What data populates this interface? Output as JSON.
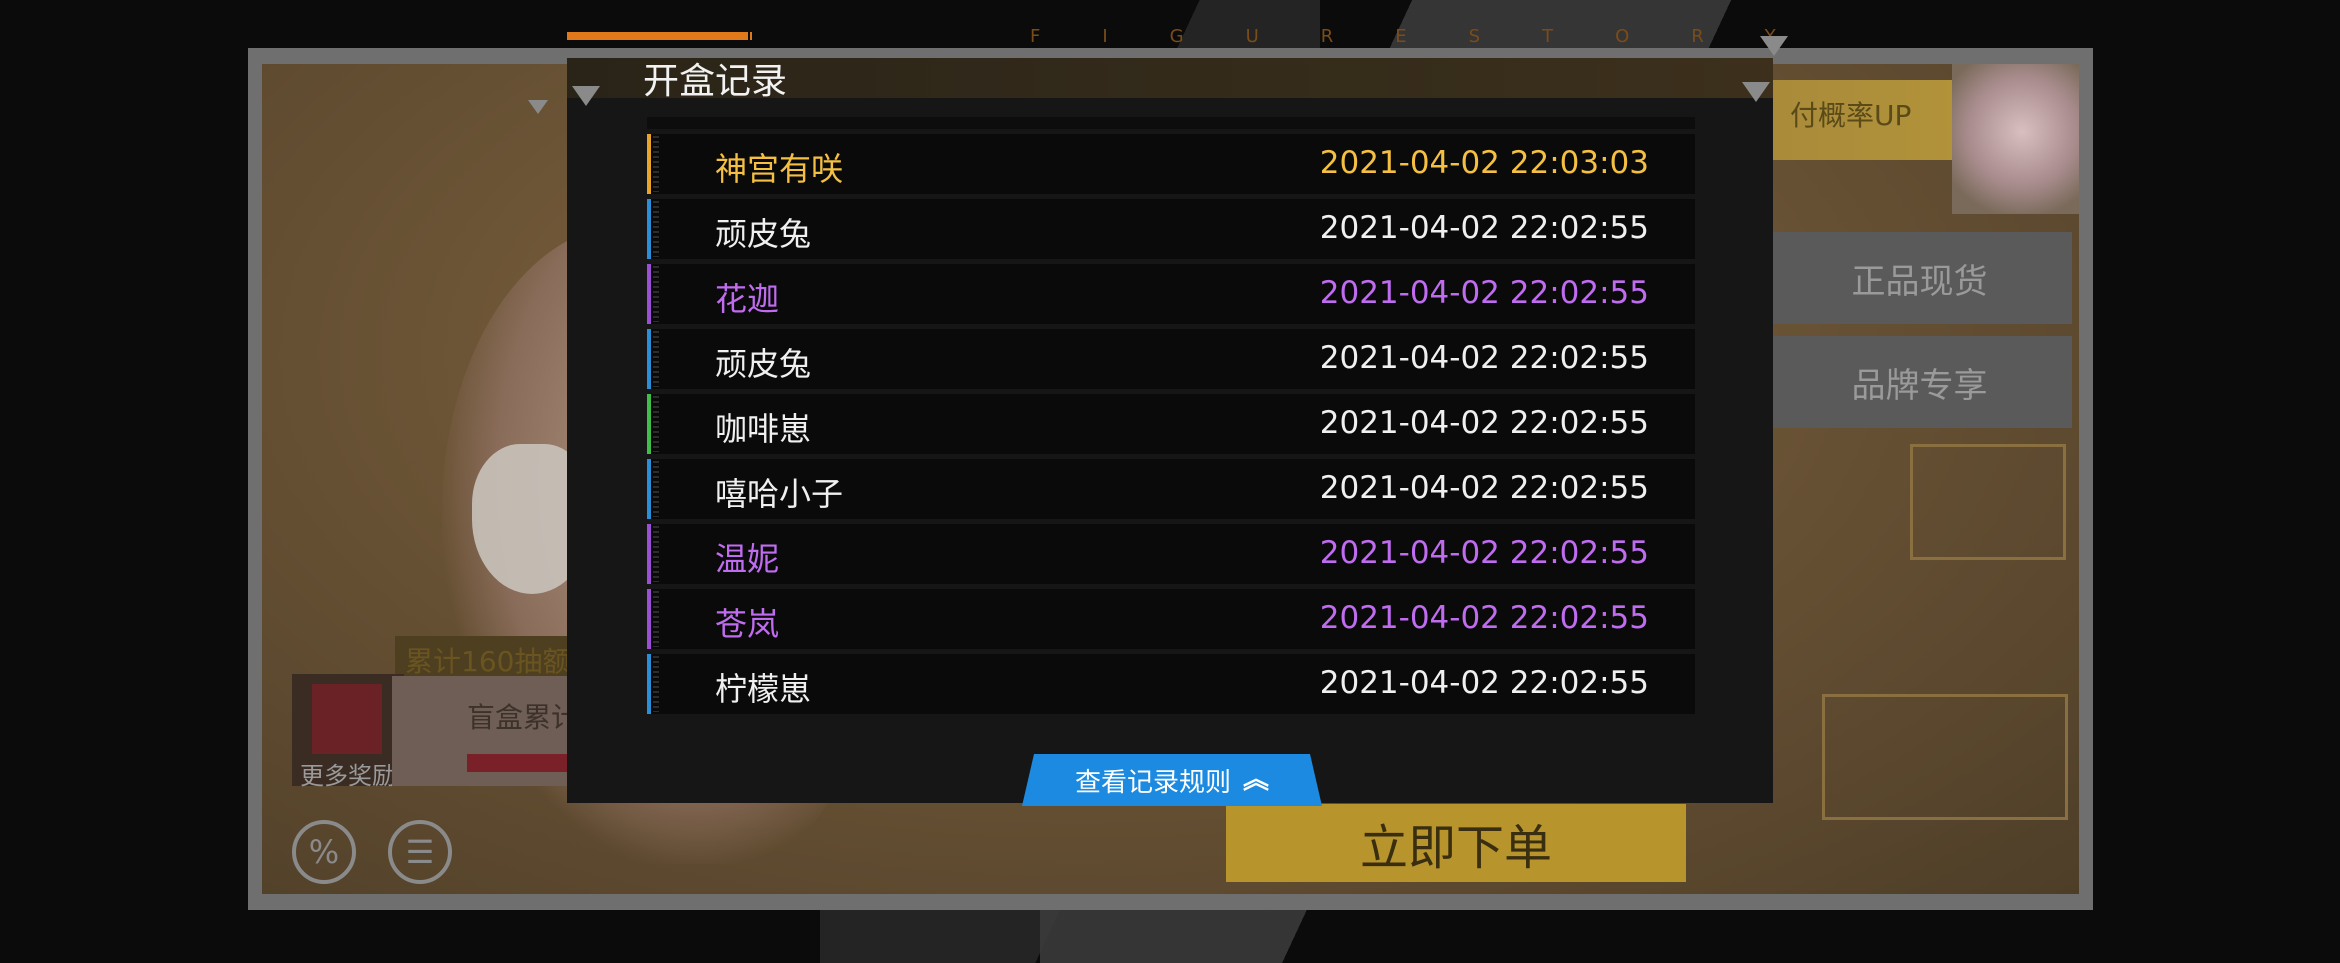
{
  "brand": {
    "text": "FIGURESTORY",
    "color": "#7a4c1a"
  },
  "colors": {
    "gold": "#f5c042",
    "white": "#f0f0f0",
    "purple": "#c06cf0",
    "orange_accent": "#e1781a",
    "blue": "#1b8ae0"
  },
  "modal": {
    "title": "开盒记录",
    "rule_button_label": "查看记录规则",
    "rule_button_icon": "double-chevron-up-icon"
  },
  "records": [
    {
      "name": "神宫有咲",
      "time": "2021-04-02 22:03:03",
      "rarity_color": "#f5c042",
      "accent": "#e8a52a"
    },
    {
      "name": "顽皮兔",
      "time": "2021-04-02 22:02:55",
      "rarity_color": "#f0f0f0",
      "accent": "#2a8fd6"
    },
    {
      "name": "花迦",
      "time": "2021-04-02 22:02:55",
      "rarity_color": "#c06cf0",
      "accent": "#9b4fd6"
    },
    {
      "name": "顽皮兔",
      "time": "2021-04-02 22:02:55",
      "rarity_color": "#f0f0f0",
      "accent": "#2a8fd6"
    },
    {
      "name": "咖啡崽",
      "time": "2021-04-02 22:02:55",
      "rarity_color": "#f0f0f0",
      "accent": "#3fbf4a"
    },
    {
      "name": "嘻哈小子",
      "time": "2021-04-02 22:02:55",
      "rarity_color": "#f0f0f0",
      "accent": "#2a8fd6"
    },
    {
      "name": "温妮",
      "time": "2021-04-02 22:02:55",
      "rarity_color": "#c06cf0",
      "accent": "#9b4fd6"
    },
    {
      "name": "苍岚",
      "time": "2021-04-02 22:02:55",
      "rarity_color": "#c06cf0",
      "accent": "#9b4fd6"
    },
    {
      "name": "柠檬崽",
      "time": "2021-04-02 22:02:55",
      "rarity_color": "#f0f0f0",
      "accent": "#2a8fd6"
    }
  ],
  "background": {
    "probability_badge": "付概率UP",
    "side_button_1": "正品现货",
    "side_button_2": "品牌专享",
    "cumulative_label": "累计160抽额",
    "more_rewards": "更多奖励",
    "blind_box_text": "盲盒累计",
    "order_button": "立即下单",
    "percent_icon": "%",
    "list_icon": "☰"
  }
}
